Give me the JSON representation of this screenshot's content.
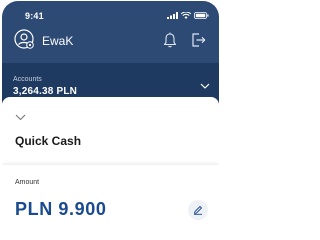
{
  "status_bar": {
    "time": "9:41",
    "icons": [
      "signal-icon",
      "wifi-icon",
      "battery-icon"
    ]
  },
  "header": {
    "username": "EwaK",
    "icons": [
      "avatar-icon",
      "bell-icon",
      "logout-icon"
    ]
  },
  "accounts": {
    "label": "Accounts",
    "balance": "3,264.38 PLN"
  },
  "sheet": {
    "title": "Quick Cash",
    "amount_label": "Amount",
    "amount_value": "PLN 9.900"
  },
  "colors": {
    "header_bg": "#2c4a74",
    "accounts_bg": "#1f3a60",
    "amount_text": "#1a4a8f"
  }
}
